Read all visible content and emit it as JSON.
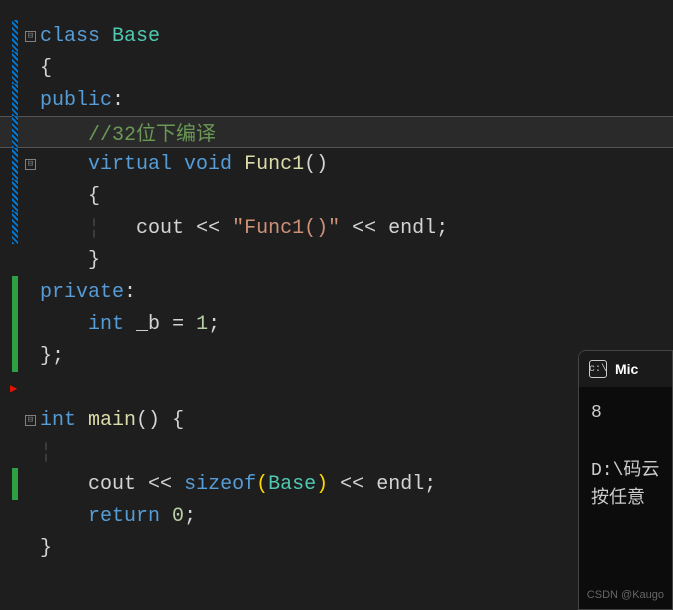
{
  "code": {
    "l1_class": "class",
    "l1_base": "Base",
    "l2_brace": "{",
    "l3_public": "public",
    "l3_colon": ":",
    "l4_comment": "//32位下编译",
    "l5_virtual": "virtual",
    "l5_void": "void",
    "l5_func": "Func1",
    "l5_parens": "()",
    "l6_brace": "{",
    "l7_cout": "cout",
    "l7_op1": "<<",
    "l7_str": "\"Func1()\"",
    "l7_op2": "<<",
    "l7_endl": "endl",
    "l7_semi": ";",
    "l8_brace": "}",
    "l9_private": "private",
    "l9_colon": ":",
    "l10_int": "int",
    "l10_var": "_b",
    "l10_eq": "=",
    "l10_num": "1",
    "l10_semi": ";",
    "l11_close": "};",
    "l13_int": "int",
    "l13_main": "main",
    "l13_parens": "()",
    "l13_brace": "{",
    "l15_cout": "cout",
    "l15_op1": "<<",
    "l15_sizeof": "sizeof",
    "l15_paren_o": "(",
    "l15_base": "Base",
    "l15_paren_c": ")",
    "l15_op2": "<<",
    "l15_endl": "endl",
    "l15_semi": ";",
    "l16_return": "return",
    "l16_num": "0",
    "l16_semi": ";",
    "l17_brace": "}"
  },
  "fold_symbol": "⊟",
  "console": {
    "title": "Mic",
    "output": "8",
    "path": "D:\\码云",
    "prompt": "按任意",
    "watermark": "CSDN @Kaugo"
  }
}
